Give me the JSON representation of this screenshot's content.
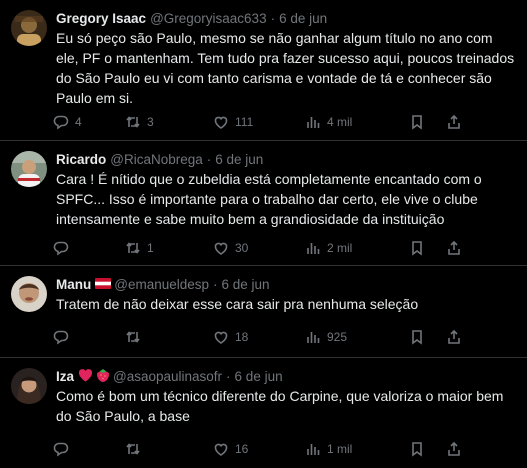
{
  "tweets": [
    {
      "name": "Gregory Isaac",
      "handle": "@Gregoryisaac633",
      "date": "6 de jun",
      "text": "Eu só peço são Paulo, mesmo se não ganhar algum título no ano com ele, PF o mantenham. Tem tudo pra fazer sucesso aqui, poucos treinados do São Paulo eu vi com tanto carisma e vontade de tá e conhecer são Paulo em si.",
      "replies": "4",
      "retweets": "3",
      "likes": "111",
      "views": "4 mil",
      "avatar_color": "#8a6a3a"
    },
    {
      "name": "Ricardo",
      "handle": "@RicaNobrega",
      "date": "6 de jun",
      "text": "Cara ! É nítido que o zubeldia está completamente encantado com o SPFC... Isso é importante para o trabalho dar certo, ele vive o clube intensamente e sabe muito bem a grandiosidade da instituição",
      "replies": "",
      "retweets": "1",
      "likes": "30",
      "views": "2 mil",
      "avatar_color": "#5a6b5c"
    },
    {
      "name": "Manu",
      "flag": "🇦🇹",
      "handle": "@emanueldesp",
      "date": "6 de jun",
      "text": "Tratem de não deixar esse cara sair pra nenhuma seleção",
      "replies": "",
      "retweets": "",
      "likes": "18",
      "views": "925",
      "avatar_color": "#b89070"
    },
    {
      "name": "Iza",
      "badges": "❤️🍓",
      "handle": "@asaopaulinasofr",
      "date": "6 de jun",
      "text": "Como é bom um técnico diferente do Carpine, que valoriza o maior bem do São Paulo, a base",
      "replies": "",
      "retweets": "",
      "likes": "16",
      "views": "1 mil",
      "avatar_color": "#6d5a4a"
    }
  ],
  "separator": "·",
  "colors": {
    "background": "#000000",
    "text": "#e7e9ea",
    "muted": "#71767b",
    "border": "#2f3336"
  }
}
